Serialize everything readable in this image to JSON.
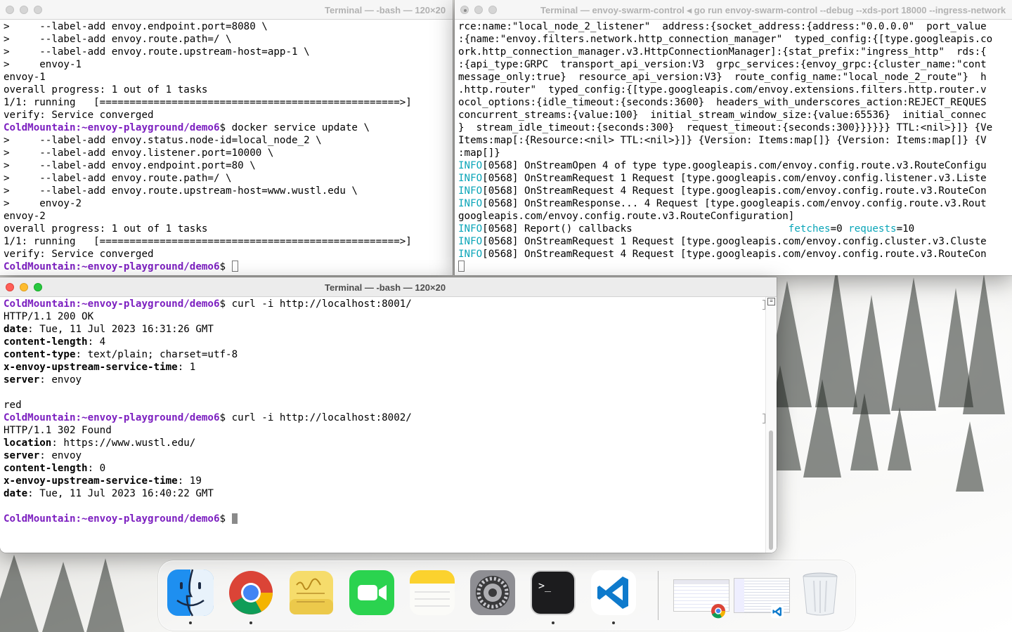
{
  "windows": {
    "top_left": {
      "title": "Terminal — -bash — 120×20",
      "lines": [
        [
          {
            "t": ">     --label-add envoy.endpoint.port=8080 \\"
          }
        ],
        [
          {
            "t": ">     --label-add envoy.route.path=/ \\"
          }
        ],
        [
          {
            "t": ">     --label-add envoy.route.upstream-host=app-1 \\"
          }
        ],
        [
          {
            "t": ">     envoy-1"
          }
        ],
        [
          {
            "t": "envoy-1"
          }
        ],
        [
          {
            "t": "overall progress: 1 out of 1 tasks"
          }
        ],
        [
          {
            "t": "1/1: running   [==================================================>]"
          }
        ],
        [
          {
            "t": "verify: Service converged"
          }
        ],
        [
          {
            "t": "ColdMountain:~envoy-playground/demo6",
            "c": "prompt"
          },
          {
            "t": "$ docker service update \\"
          }
        ],
        [
          {
            "t": ">     --label-add envoy.status.node-id=local_node_2 \\"
          }
        ],
        [
          {
            "t": ">     --label-add envoy.listener.port=10000 \\"
          }
        ],
        [
          {
            "t": ">     --label-add envoy.endpoint.port=80 \\"
          }
        ],
        [
          {
            "t": ">     --label-add envoy.route.path=/ \\"
          }
        ],
        [
          {
            "t": ">     --label-add envoy.route.upstream-host=www.wustl.edu \\"
          }
        ],
        [
          {
            "t": ">     envoy-2"
          }
        ],
        [
          {
            "t": "envoy-2"
          }
        ],
        [
          {
            "t": "overall progress: 1 out of 1 tasks"
          }
        ],
        [
          {
            "t": "1/1: running   [==================================================>]"
          }
        ],
        [
          {
            "t": "verify: Service converged"
          }
        ],
        [
          {
            "t": "ColdMountain:~envoy-playground/demo6",
            "c": "prompt"
          },
          {
            "t": "$ "
          },
          {
            "cursor": "hollow"
          }
        ]
      ]
    },
    "top_right": {
      "title": "Terminal — envoy-swarm-control ◂ go run envoy-swarm-control --debug --xds-port 18000 --ingress-network",
      "lines": [
        [
          {
            "t": "rce:name:\"local_node_2_listener\"  address:{socket_address:{address:\"0.0.0.0\"  port_value"
          }
        ],
        [
          {
            "t": ":{name:\"envoy.filters.network.http_connection_manager\"  typed_config:{[type.googleapis.co"
          }
        ],
        [
          {
            "t": "ork.http_connection_manager.v3.HttpConnectionManager]:{stat_prefix:\"ingress_http\"  rds:{"
          }
        ],
        [
          {
            "t": ":{api_type:GRPC  transport_api_version:V3  grpc_services:{envoy_grpc:{cluster_name:\"cont"
          }
        ],
        [
          {
            "t": "message_only:true}  resource_api_version:V3}  route_config_name:\"local_node_2_route\"}  h"
          }
        ],
        [
          {
            "t": ".http.router\"  typed_config:{[type.googleapis.com/envoy.extensions.filters.http.router.v"
          }
        ],
        [
          {
            "t": "ocol_options:{idle_timeout:{seconds:3600}  headers_with_underscores_action:REJECT_REQUES"
          }
        ],
        [
          {
            "t": "concurrent_streams:{value:100}  initial_stream_window_size:{value:65536}  initial_connec"
          }
        ],
        [
          {
            "t": "}  stream_idle_timeout:{seconds:300}  request_timeout:{seconds:300}}}}}} TTL:<nil>}]} {Ve"
          }
        ],
        [
          {
            "t": "Items:map[:{Resource:<nil> TTL:<nil>}]} {Version: Items:map[]} {Version: Items:map[]} {V"
          }
        ],
        [
          {
            "t": ":map[]}"
          }
        ],
        [
          {
            "t": "INFO",
            "c": "info"
          },
          {
            "t": "[0568] OnStreamOpen 4 of type type.googleapis.com/envoy.config.route.v3.RouteConfigu"
          }
        ],
        [
          {
            "t": "INFO",
            "c": "info"
          },
          {
            "t": "[0568] OnStreamRequest 1 Request [type.googleapis.com/envoy.config.listener.v3.Liste"
          }
        ],
        [
          {
            "t": "INFO",
            "c": "info"
          },
          {
            "t": "[0568] OnStreamRequest 4 Request [type.googleapis.com/envoy.config.route.v3.RouteCon"
          }
        ],
        [
          {
            "t": "INFO",
            "c": "info"
          },
          {
            "t": "[0568] OnStreamResponse... 4 Request [type.googleapis.com/envoy.config.route.v3.Rout"
          }
        ],
        [
          {
            "t": "googleapis.com/envoy.config.route.v3.RouteConfiguration]"
          }
        ],
        [
          {
            "t": "INFO",
            "c": "info"
          },
          {
            "t": "[0568] Report() callbacks                          "
          },
          {
            "t": "fetches",
            "c": "info"
          },
          {
            "t": "=0 "
          },
          {
            "t": "requests",
            "c": "info"
          },
          {
            "t": "=10"
          }
        ],
        [
          {
            "t": "INFO",
            "c": "info"
          },
          {
            "t": "[0568] OnStreamRequest 1 Request [type.googleapis.com/envoy.config.cluster.v3.Cluste"
          }
        ],
        [
          {
            "t": "INFO",
            "c": "info"
          },
          {
            "t": "[0568] OnStreamRequest 4 Request [type.googleapis.com/envoy.config.route.v3.RouteCon"
          }
        ],
        [
          {
            "cursor": "hollow"
          }
        ]
      ]
    },
    "bottom": {
      "title": "Terminal — -bash — 120×20",
      "lines": [
        [
          {
            "t": "ColdMountain:~envoy-playground/demo6",
            "c": "prompt"
          },
          {
            "t": "$ curl -i http://localhost:8001/"
          }
        ],
        [
          {
            "t": "HTTP/1.1 200 OK"
          }
        ],
        [
          {
            "t": "date",
            "c": "hk"
          },
          {
            "t": ": Tue, 11 Jul 2023 16:31:26 GMT"
          }
        ],
        [
          {
            "t": "content-length",
            "c": "hk"
          },
          {
            "t": ": 4"
          }
        ],
        [
          {
            "t": "content-type",
            "c": "hk"
          },
          {
            "t": ": text/plain; charset=utf-8"
          }
        ],
        [
          {
            "t": "x-envoy-upstream-service-time",
            "c": "hk"
          },
          {
            "t": ": 1"
          }
        ],
        [
          {
            "t": "server",
            "c": "hk"
          },
          {
            "t": ": envoy"
          }
        ],
        [
          {
            "t": ""
          }
        ],
        [
          {
            "t": "red"
          }
        ],
        [
          {
            "t": "ColdMountain:~envoy-playground/demo6",
            "c": "prompt"
          },
          {
            "t": "$ curl -i http://localhost:8002/"
          }
        ],
        [
          {
            "t": "HTTP/1.1 302 Found"
          }
        ],
        [
          {
            "t": "location",
            "c": "hk"
          },
          {
            "t": ": https://www.wustl.edu/"
          }
        ],
        [
          {
            "t": "server",
            "c": "hk"
          },
          {
            "t": ": envoy"
          }
        ],
        [
          {
            "t": "content-length",
            "c": "hk"
          },
          {
            "t": ": 0"
          }
        ],
        [
          {
            "t": "x-envoy-upstream-service-time",
            "c": "hk"
          },
          {
            "t": ": 19"
          }
        ],
        [
          {
            "t": "date",
            "c": "hk"
          },
          {
            "t": ": Tue, 11 Jul 2023 16:40:22 GMT"
          }
        ],
        [
          {
            "t": ""
          }
        ],
        [
          {
            "t": "ColdMountain:~envoy-playground/demo6",
            "c": "prompt"
          },
          {
            "t": "$ "
          },
          {
            "cursor": "solid"
          }
        ]
      ]
    }
  },
  "dock": {
    "apps": [
      {
        "name": "finder-icon",
        "running": true
      },
      {
        "name": "chrome-icon",
        "running": true
      },
      {
        "name": "stickies-icon",
        "running": false
      },
      {
        "name": "facetime-icon",
        "running": false
      },
      {
        "name": "notes-icon",
        "running": false
      },
      {
        "name": "system-settings-icon",
        "running": false
      },
      {
        "name": "terminal-icon",
        "running": true
      },
      {
        "name": "vscode-icon",
        "running": true
      }
    ],
    "terminal_icon_text": ">_",
    "colors": {
      "prompt": "#7c1fc0",
      "info": "#0aa5b8"
    }
  }
}
